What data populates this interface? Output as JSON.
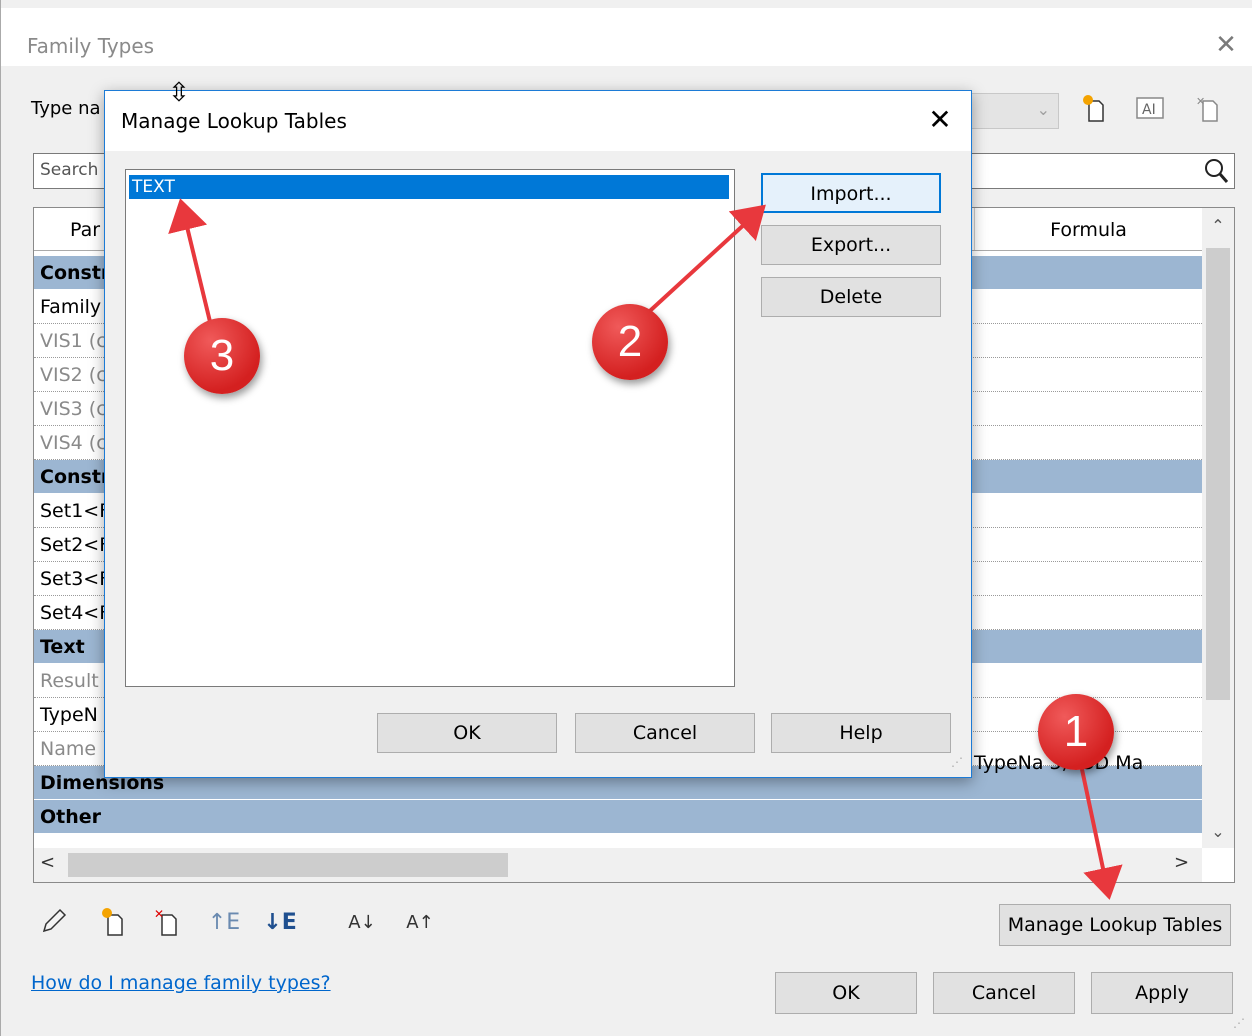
{
  "outer_dialog": {
    "title": "Family Types",
    "type_name_label": "Type na",
    "search_placeholder": "Search",
    "grid": {
      "col_parameter": "Par",
      "col_formula": "Formula",
      "rows": [
        {
          "text": "Constr",
          "kind": "group"
        },
        {
          "text": "Family",
          "kind": "param"
        },
        {
          "text": "VIS1 (c",
          "kind": "readonly"
        },
        {
          "text": "VIS2 (c",
          "kind": "readonly"
        },
        {
          "text": "VIS3 (c",
          "kind": "readonly"
        },
        {
          "text": "VIS4 (c",
          "kind": "readonly"
        },
        {
          "text": "Constr",
          "kind": "group"
        },
        {
          "text": "Set1<F",
          "kind": "param"
        },
        {
          "text": "Set2<F",
          "kind": "param"
        },
        {
          "text": "Set3<F",
          "kind": "param"
        },
        {
          "text": "Set4<F",
          "kind": "param"
        },
        {
          "text": "Text",
          "kind": "group"
        },
        {
          "text": "Result",
          "kind": "readonly"
        },
        {
          "text": "TypeN",
          "kind": "param"
        },
        {
          "text": "Name",
          "kind": "readonly"
        },
        {
          "text": "Dimensions",
          "kind": "group"
        },
        {
          "text": "Other",
          "kind": "group"
        }
      ],
      "formula_visible": "TypeNa    3, \"3D Ma"
    },
    "manage_lookup_button": "Manage Lookup Tables",
    "help_link": "How do I manage family types?",
    "ok": "OK",
    "cancel": "Cancel",
    "apply": "Apply",
    "toolbar_icons": [
      "pencil-icon",
      "new-type-icon",
      "delete-type-icon",
      "move-up-icon",
      "move-down-icon",
      "sort-ascending-icon",
      "sort-descending-icon"
    ]
  },
  "inner_dialog": {
    "title": "Manage Lookup Tables",
    "tables": [
      "TEXT"
    ],
    "import": "Import...",
    "export": "Export...",
    "delete": "Delete",
    "ok": "OK",
    "cancel": "Cancel",
    "help": "Help"
  },
  "callouts": [
    "1",
    "2",
    "3"
  ],
  "colors": {
    "group_row": "#9cb6d2",
    "selection": "#0078d7",
    "callout": "#d42020",
    "link": "#0066cc"
  }
}
